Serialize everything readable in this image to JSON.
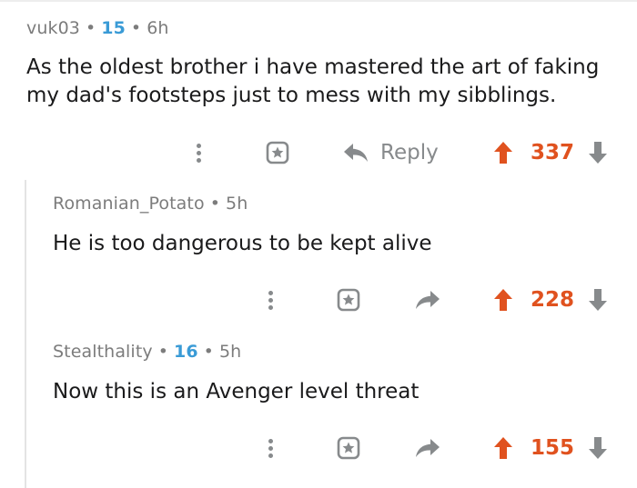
{
  "comments": [
    {
      "username": "vuk03",
      "flair": "15",
      "age": "6h",
      "text_line1": "As the oldest brother i have mastered the art of faking",
      "text_line2": "my dad's footsteps just to mess with my sibblings.",
      "reply_label": "Reply",
      "votes": "337"
    },
    {
      "username": "Romanian_Potato",
      "age": "5h",
      "text": "He is too dangerous to be kept alive",
      "votes": "228"
    },
    {
      "username": "Stealthality",
      "flair": "16",
      "age": "5h",
      "text": "Now this is an Avenger level threat",
      "votes": "155"
    }
  ],
  "colors": {
    "flair": "#3a9bd6",
    "upvote": "#e0521f",
    "muted": "#878a8c",
    "text": "#1a1a1b"
  },
  "icons": [
    "more-options-icon",
    "award-icon",
    "reply-arrow-icon",
    "upvote-arrow-icon",
    "downvote-arrow-icon"
  ]
}
